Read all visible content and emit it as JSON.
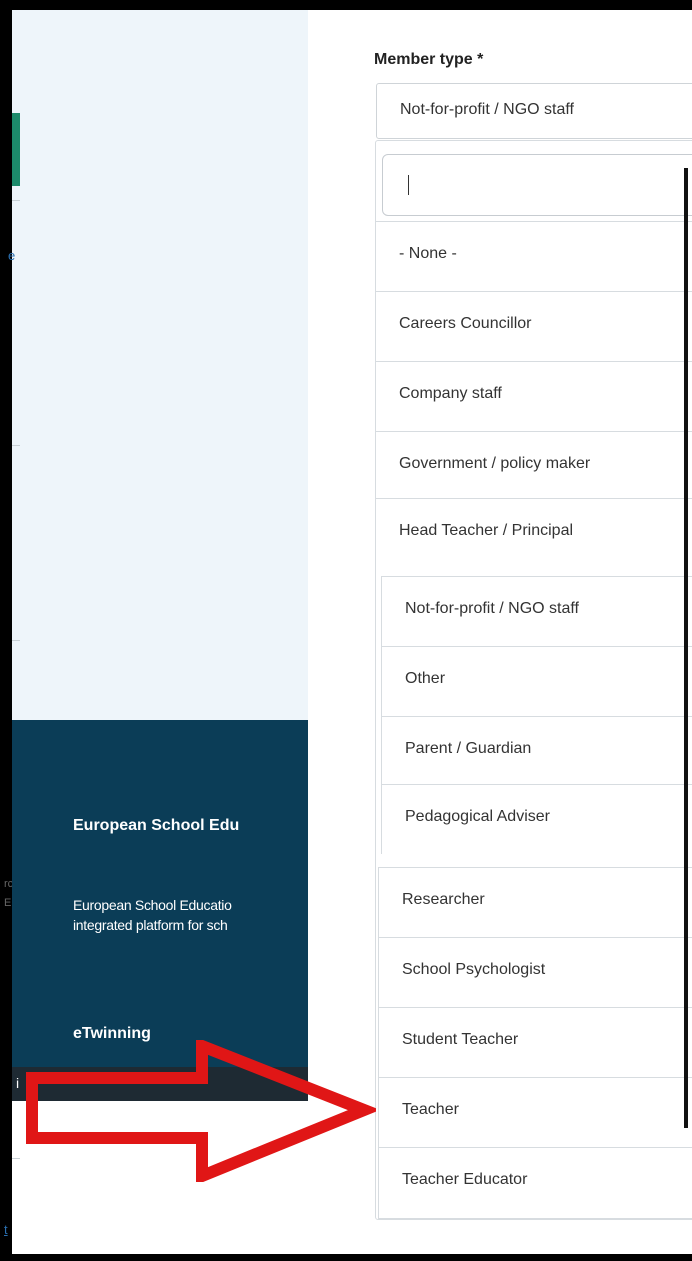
{
  "field": {
    "label": "Member type *",
    "selected_value": "Not-for-profit / NGO staff",
    "search_value": ""
  },
  "options": [
    "- None -",
    "Careers Councillor",
    "Company staff",
    "Government / policy maker",
    "Head Teacher / Principal",
    "Not-for-profit / NGO staff",
    "Other",
    "Parent / Guardian",
    "Pedagogical Adviser",
    "Researcher",
    "School Psychologist",
    "Student Teacher",
    "Teacher",
    "Teacher Educator"
  ],
  "footer": {
    "title": "European School Edu",
    "desc_line1": "European School Educatio",
    "desc_line2": "integrated platform for sch",
    "link": "eTwinning"
  },
  "left_fragments": {
    "a": "e",
    "b": "rc",
    "c": "E",
    "d": "t",
    "e": "i"
  },
  "colors": {
    "annotation_arrow": "#e01616",
    "footer_bg": "#0b3d57",
    "accent_green": "#1c8a6a"
  }
}
